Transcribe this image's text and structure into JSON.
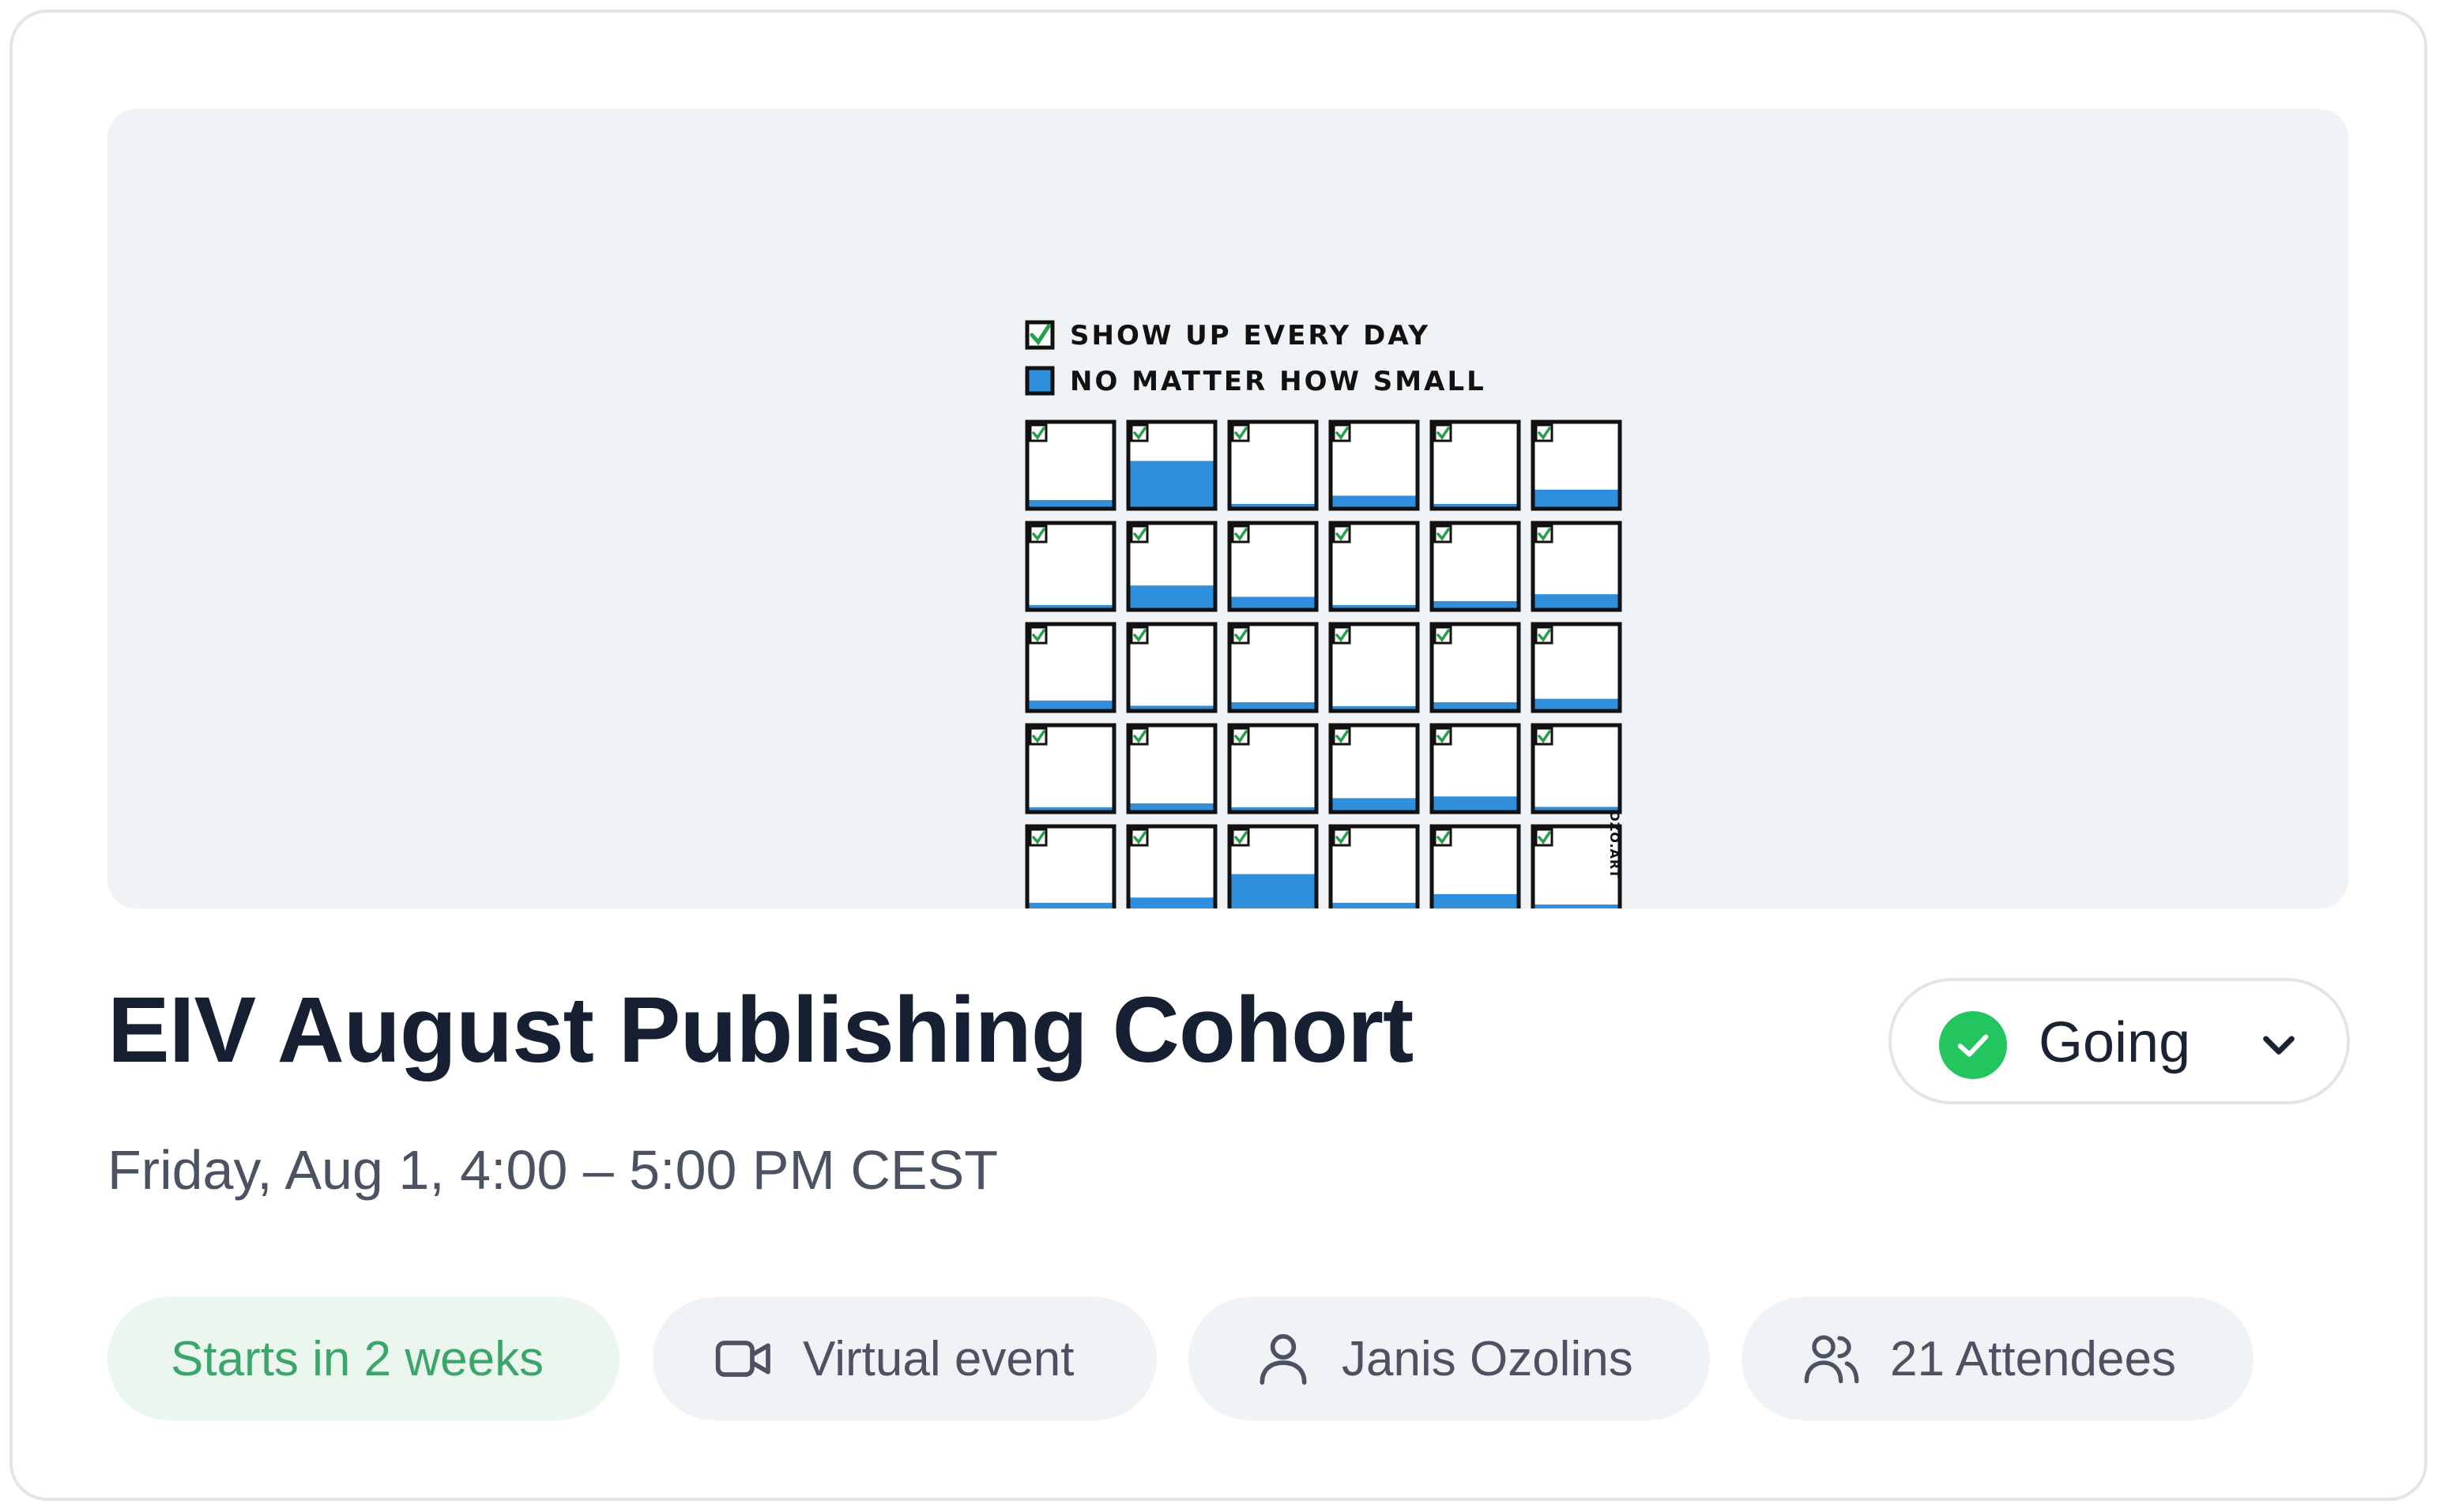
{
  "event": {
    "title": "EIV August Publishing Cohort",
    "datetime": "Friday, Aug 1, 4:00 – 5:00 PM CEST"
  },
  "banner": {
    "line1": "SHOW UP EVERY DAY",
    "line2": "NO MATTER HOW SMALL",
    "credit": "OZO.ART",
    "grid_rows": 5,
    "grid_cols": 6,
    "fill_levels": [
      [
        0.1,
        0.55,
        0.05,
        0.15,
        0.05,
        0.22
      ],
      [
        0.05,
        0.28,
        0.15,
        0.05,
        0.1,
        0.18
      ],
      [
        0.12,
        0.06,
        0.1,
        0.05,
        0.1,
        0.14
      ],
      [
        0.05,
        0.1,
        0.05,
        0.16,
        0.18,
        0.06
      ],
      [
        0.12,
        0.18,
        0.45,
        0.12,
        0.22,
        0.1
      ]
    ]
  },
  "rsvp": {
    "label": "Going",
    "status_color": "#22c55e"
  },
  "chips": {
    "starts": "Starts in 2 weeks",
    "virtual": "Virtual event",
    "host": "Janis Ozolins",
    "attendees": "21 Attendees"
  },
  "icons": {
    "rsvp_status": "check-circle-icon",
    "rsvp_dropdown": "chevron-down-icon",
    "virtual": "video-camera-icon",
    "host": "user-icon",
    "attendees": "users-icon"
  },
  "colors": {
    "accent_blue": "#2f8fdc",
    "success_green": "#22c55e",
    "starts_text": "#3ba66a"
  }
}
